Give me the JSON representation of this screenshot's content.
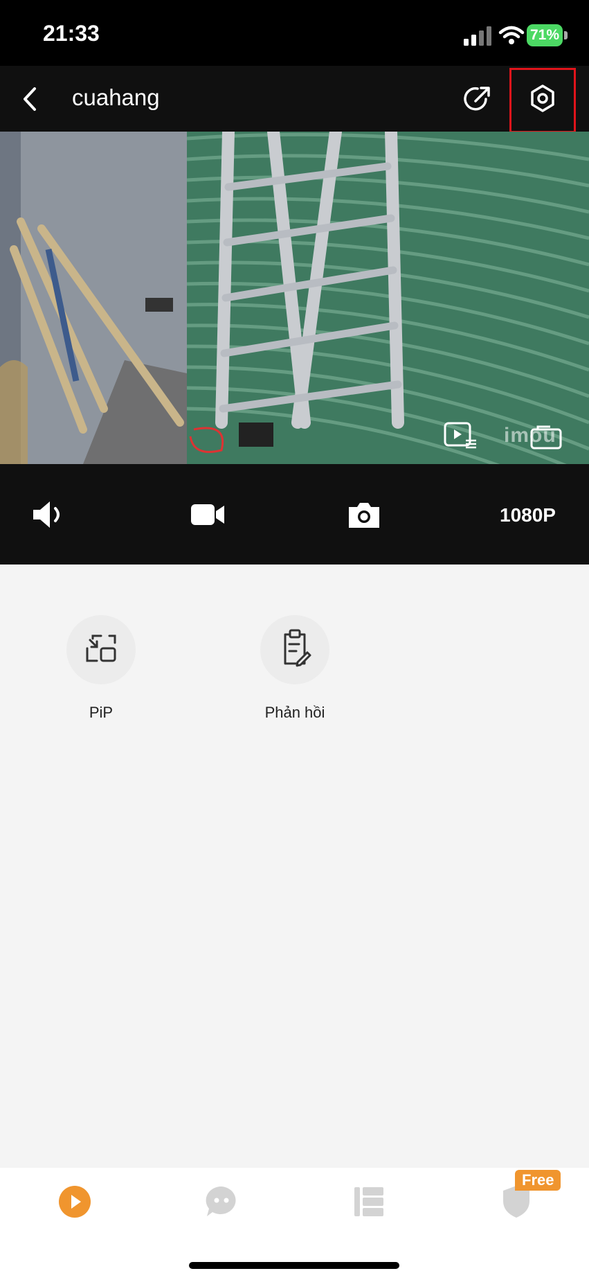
{
  "status_bar": {
    "time": "21:33",
    "battery": "71%"
  },
  "nav": {
    "title": "cuahang"
  },
  "video": {
    "watermark": "imou"
  },
  "controls": {
    "resolution": "1080P"
  },
  "features": [
    {
      "label": "PiP",
      "icon": "pip-icon"
    },
    {
      "label": "Phản hồi",
      "icon": "feedback-clipboard-icon"
    }
  ],
  "tab_bar": {
    "badge": "Free",
    "tabs": [
      {
        "icon": "play-icon",
        "active": true
      },
      {
        "icon": "chat-icon",
        "active": false
      },
      {
        "icon": "list-icon",
        "active": false
      },
      {
        "icon": "shield-icon",
        "active": false
      }
    ]
  },
  "colors": {
    "accent": "#f0952e",
    "highlight": "#e0141b",
    "battery": "#4cd964"
  }
}
